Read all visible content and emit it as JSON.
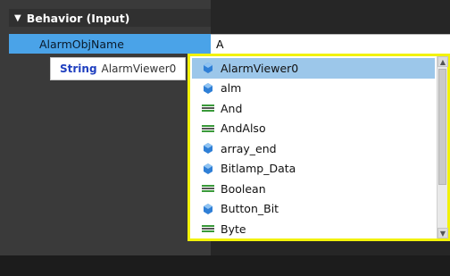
{
  "section": {
    "title": "Behavior (Input)",
    "expander": "▼"
  },
  "property": {
    "name": "AlarmObjName",
    "value": "A"
  },
  "tooltip": {
    "type": "String",
    "name": "AlarmViewer0"
  },
  "completion": {
    "items": [
      {
        "label": "AlarmViewer0",
        "icon": "member-icon",
        "selected": true
      },
      {
        "label": "alm",
        "icon": "member-icon",
        "selected": false
      },
      {
        "label": "And",
        "icon": "keyword-icon",
        "selected": false
      },
      {
        "label": "AndAlso",
        "icon": "keyword-icon",
        "selected": false
      },
      {
        "label": "array_end",
        "icon": "member-icon",
        "selected": false
      },
      {
        "label": "Bitlamp_Data",
        "icon": "member-icon",
        "selected": false
      },
      {
        "label": "Boolean",
        "icon": "keyword-icon",
        "selected": false
      },
      {
        "label": "Button_Bit",
        "icon": "member-icon",
        "selected": false
      },
      {
        "label": "Byte",
        "icon": "keyword-icon",
        "selected": false
      }
    ]
  },
  "colors": {
    "highlight_border": "#f2f20a",
    "selected_row": "#9cc7ea",
    "property_name_bg": "#4aa3e8",
    "keyword_blue": "#1f3fbf"
  }
}
